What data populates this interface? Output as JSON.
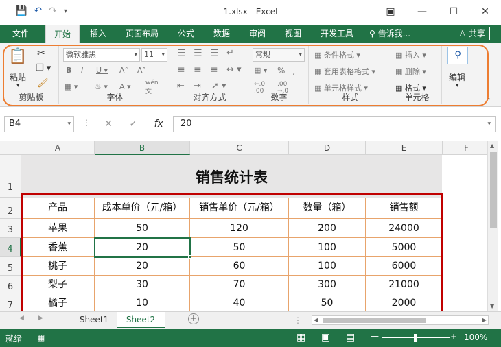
{
  "window": {
    "title": "1.xlsx - Excel"
  },
  "tabs": [
    {
      "label": "文件"
    },
    {
      "label": "开始"
    },
    {
      "label": "插入"
    },
    {
      "label": "页面布局"
    },
    {
      "label": "公式"
    },
    {
      "label": "数据"
    },
    {
      "label": "审阅"
    },
    {
      "label": "视图"
    },
    {
      "label": "开发工具"
    }
  ],
  "tell_me": "告诉我...",
  "share": "共享",
  "ribbon": {
    "clipboard": {
      "paste": "粘贴",
      "label": "剪贴板"
    },
    "font": {
      "name": "微软雅黑",
      "size": "11",
      "label": "字体"
    },
    "alignment": {
      "label": "对齐方式"
    },
    "number": {
      "format": "常规",
      "label": "数字"
    },
    "styles": {
      "conditional": "条件格式",
      "table": "套用表格格式",
      "cell": "单元格样式",
      "label": "样式"
    },
    "cells": {
      "insert": "插入",
      "delete": "删除",
      "format": "格式",
      "label": "单元格"
    },
    "editing": {
      "label": "编辑"
    }
  },
  "formula_bar": {
    "name_box": "B4",
    "fx": "fx",
    "value": "20"
  },
  "grid": {
    "columns": [
      "A",
      "B",
      "C",
      "D",
      "E",
      "F"
    ],
    "rows": [
      "1",
      "2",
      "3",
      "4",
      "5",
      "6",
      "7"
    ],
    "title": "销售统计表",
    "headers": [
      "产品",
      "成本单价（元/箱）",
      "销售单价（元/箱）",
      "数量（箱）",
      "销售额"
    ],
    "data": [
      [
        "苹果",
        "50",
        "120",
        "200",
        "24000"
      ],
      [
        "香蕉",
        "20",
        "50",
        "100",
        "5000"
      ],
      [
        "桃子",
        "20",
        "60",
        "100",
        "6000"
      ],
      [
        "梨子",
        "30",
        "70",
        "300",
        "21000"
      ],
      [
        "橘子",
        "10",
        "40",
        "50",
        "2000"
      ]
    ]
  },
  "sheets": [
    {
      "label": "Sheet1"
    },
    {
      "label": "Sheet2"
    }
  ],
  "status": {
    "ready": "就绪",
    "zoom": "100%"
  },
  "colors": {
    "excel_green": "#217346",
    "highlight_orange": "#ed7d31",
    "table_red": "#c00000"
  }
}
